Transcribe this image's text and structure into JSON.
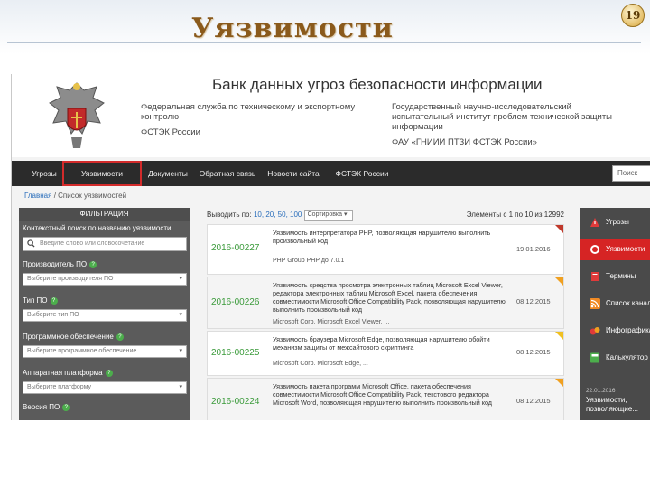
{
  "slide": {
    "title": "Уязвимости",
    "page_number": "19"
  },
  "site": {
    "title": "Банк данных угроз безопасности информации",
    "org_left": {
      "name": "Федеральная служба по техническому и экспортному контролю",
      "abbr": "ФСТЭК России"
    },
    "org_right": {
      "name": "Государственный научно-исследовательский испытательный институт проблем технической защиты информации",
      "abbr": "ФАУ «ГНИИИ ПТЗИ ФСТЭК России»"
    }
  },
  "nav": {
    "items": [
      "Угрозы",
      "Уязвимости",
      "Документы",
      "Обратная связь",
      "Новости сайта",
      "ФСТЭК России"
    ],
    "active_index": 1,
    "search_placeholder": "Поиск"
  },
  "breadcrumb": {
    "home": "Главная",
    "separator": "/",
    "current": "Список уязвимостей"
  },
  "filter": {
    "header": "ФИЛЬТРАЦИЯ",
    "search_label": "Контекстный поиск по названию уязвимости",
    "search_placeholder": "Введите слово или словосочетание",
    "vendor_label": "Производитель ПО",
    "vendor_placeholder": "Выберите производителя ПО",
    "type_label": "Тип ПО",
    "type_placeholder": "Выберите тип ПО",
    "software_label": "Программное обеспечение",
    "software_placeholder": "Выберите программное обеспечение",
    "platform_label": "Аппаратная платформа",
    "platform_placeholder": "Выберите платформу",
    "version_label": "Версия ПО"
  },
  "list": {
    "show_label": "Выводить по:",
    "per_page_options": [
      "10",
      "20",
      "50",
      "100"
    ],
    "sort_value": "Сортировка",
    "count_text": "Элементы с 1 по 10 из 12992",
    "rows": [
      {
        "id": "2016-00227",
        "desc": "Уязвимость интерпретатора PHP, позволяющая нарушителю выполнить произвольный код",
        "date": "19.01.2016",
        "vendor": "PHP Group PHP до 7.0.1",
        "severity_color": "#c0392b"
      },
      {
        "id": "2016-00226",
        "desc": "Уязвимость средства просмотра электронных таблиц Microsoft Excel Viewer, редактора электронных таблиц Microsoft Excel, пакета обеспечения совместимости Microsoft Office Compatibility Pack, позволяющая нарушителю выполнить произвольный код",
        "date": "08.12.2015",
        "vendor": "Microsoft Corp. Microsoft Excel Viewer, ...",
        "severity_color": "#f0a020"
      },
      {
        "id": "2016-00225",
        "desc": "Уязвимость браузера Microsoft Edge, позволяющая нарушителю обойти механизм защиты от межсайтового скриптинга",
        "date": "08.12.2015",
        "vendor": "Microsoft Corp. Microsoft Edge, ...",
        "severity_color": "#f0c020"
      },
      {
        "id": "2016-00224",
        "desc": "Уязвимость пакета программ Microsoft Office, пакета обеспечения совместимости Microsoft Office Compatibility Pack, текстового редактора Microsoft Word, позволяющая нарушителю выполнить произвольный код",
        "date": "08.12.2015",
        "vendor": "",
        "severity_color": "#f0a020"
      }
    ]
  },
  "side_menu": {
    "items": [
      {
        "label": "Угрозы",
        "icon": "warning-icon"
      },
      {
        "label": "Уязвимости",
        "icon": "bug-icon"
      },
      {
        "label": "Термины",
        "icon": "book-icon"
      },
      {
        "label": "Список каналов",
        "icon": "rss-icon"
      },
      {
        "label": "Инфографика",
        "icon": "chart-icon"
      },
      {
        "label": "Калькулятор",
        "icon": "calculator-icon"
      }
    ],
    "active_index": 1,
    "news_date": "22.01.2016",
    "news_text": "Уязвимости, позволяющие..."
  }
}
